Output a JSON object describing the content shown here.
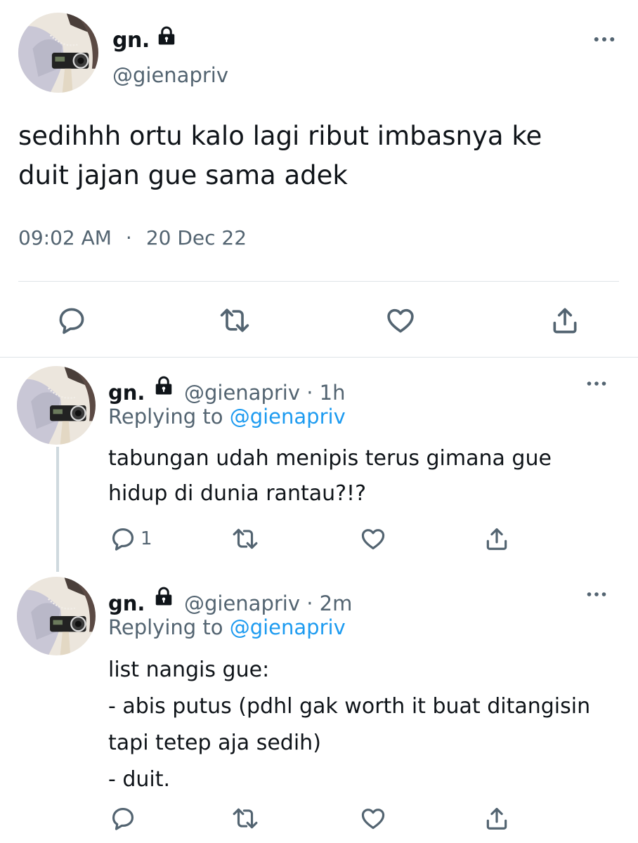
{
  "main_tweet": {
    "name": "gn.",
    "handle": "@gienapriv",
    "text_lines": [
      "sedihhh ortu kalo lagi ribut imbasnya ke",
      "duit jajan gue sama adek"
    ],
    "time": "09:02 AM",
    "separator": "·",
    "date": "20 Dec 22"
  },
  "replies": [
    {
      "name": "gn.",
      "handle_time": "@gienapriv · 1h",
      "replying_prefix": "Replying to",
      "replying_handle": "@gienapriv",
      "text_lines": [
        "tabungan udah menipis terus gimana gue",
        "hidup di dunia rantau?!?"
      ],
      "reply_count": "1"
    },
    {
      "name": "gn.",
      "handle_time": "@gienapriv · 2m",
      "replying_prefix": "Replying to",
      "replying_handle": "@gienapriv",
      "text_lines": [
        "list nangis gue:",
        "- abis putus (pdhl gak worth it buat ditangisin",
        "tapi tetep aja sedih)",
        "- duit."
      ],
      "reply_count": ""
    }
  ],
  "icons": {
    "reply": "comment-icon",
    "retweet": "retweet-icon",
    "like": "heart-icon",
    "share": "share-icon",
    "lock": "lock-icon",
    "more": "more-icon"
  },
  "colors": {
    "text": "#0f1419",
    "secondary": "#536471",
    "link": "#1d9bf0",
    "divider": "#dfe4e8"
  }
}
